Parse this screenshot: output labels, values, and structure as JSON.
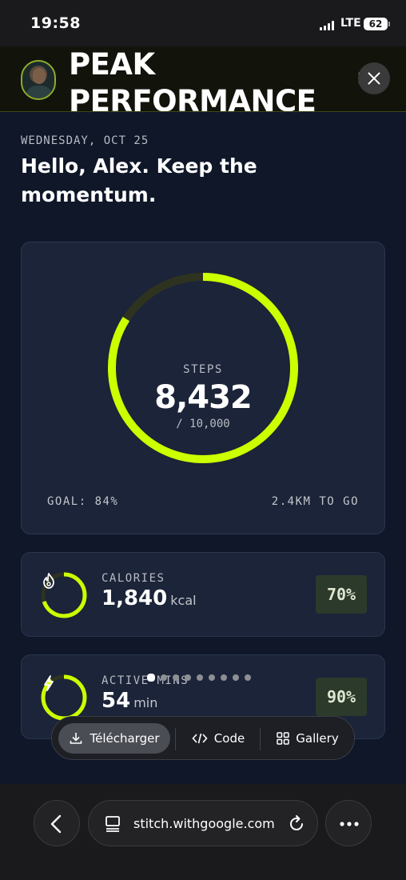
{
  "status_bar": {
    "time": "19:58",
    "network": "LTE",
    "battery": "62"
  },
  "header": {
    "title": "PEAK PERFORMANCE",
    "trailing_char": "S",
    "avatar_icon": "user-avatar",
    "close_icon": "close-icon"
  },
  "greeting": {
    "date": "WEDNESDAY, OCT 25",
    "message": "Hello, Alex. Keep the momentum."
  },
  "steps": {
    "label": "STEPS",
    "value": "8,432",
    "goal_text": "/ 10,000",
    "progress": 0.84,
    "goal_pct": "GOAL: 84%",
    "remaining": "2.4KM TO GO"
  },
  "metrics": [
    {
      "label": "CALORIES",
      "value": "1,840",
      "unit": "kcal",
      "percent": "70%",
      "progress": 0.7,
      "icon": "flame-icon"
    },
    {
      "label": "ACTIVE MINS",
      "value": "54",
      "unit": "min",
      "percent": "90%",
      "progress": 0.9,
      "icon": "bolt-icon"
    }
  ],
  "pager": {
    "count": 9,
    "active_index": 0
  },
  "toolbar": {
    "download_label": "Télécharger",
    "code_label": "Code",
    "gallery_label": "Gallery"
  },
  "browser": {
    "url": "stitch.withgoogle.com"
  },
  "colors": {
    "accent": "#ccff00",
    "background": "#0f1729",
    "card": "#1b2438",
    "track": "#2e3320"
  }
}
